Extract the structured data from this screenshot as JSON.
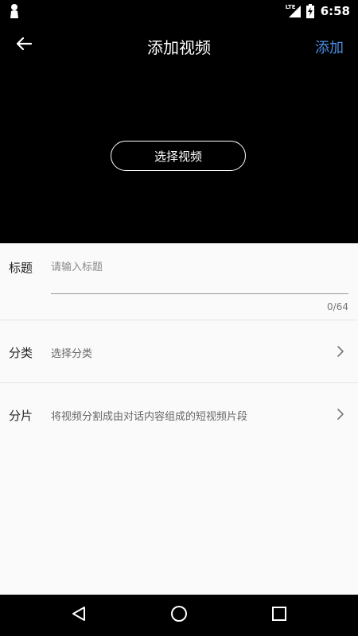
{
  "status_bar": {
    "time": "6:58",
    "network": "LTE",
    "icons": [
      "lock-person-icon",
      "lte-signal-icon",
      "battery-charging-icon"
    ]
  },
  "toolbar": {
    "back_icon": "arrow-left-icon",
    "title": "添加视频",
    "add_label": "添加",
    "accent_color": "#4a90e2"
  },
  "video_area": {
    "select_button_label": "选择视频"
  },
  "form": {
    "title_row": {
      "label": "标题",
      "placeholder": "请输入标题",
      "value": "",
      "counter": "0/64"
    },
    "category_row": {
      "label": "分类",
      "value": "选择分类",
      "icon": "chevron-right-icon"
    },
    "segment_row": {
      "label": "分片",
      "value": "将视频分割成由对话内容组成的短视频片段",
      "icon": "chevron-right-icon"
    }
  },
  "nav_bar": {
    "icons": [
      "back-triangle-icon",
      "home-circle-icon",
      "recents-square-icon"
    ]
  }
}
